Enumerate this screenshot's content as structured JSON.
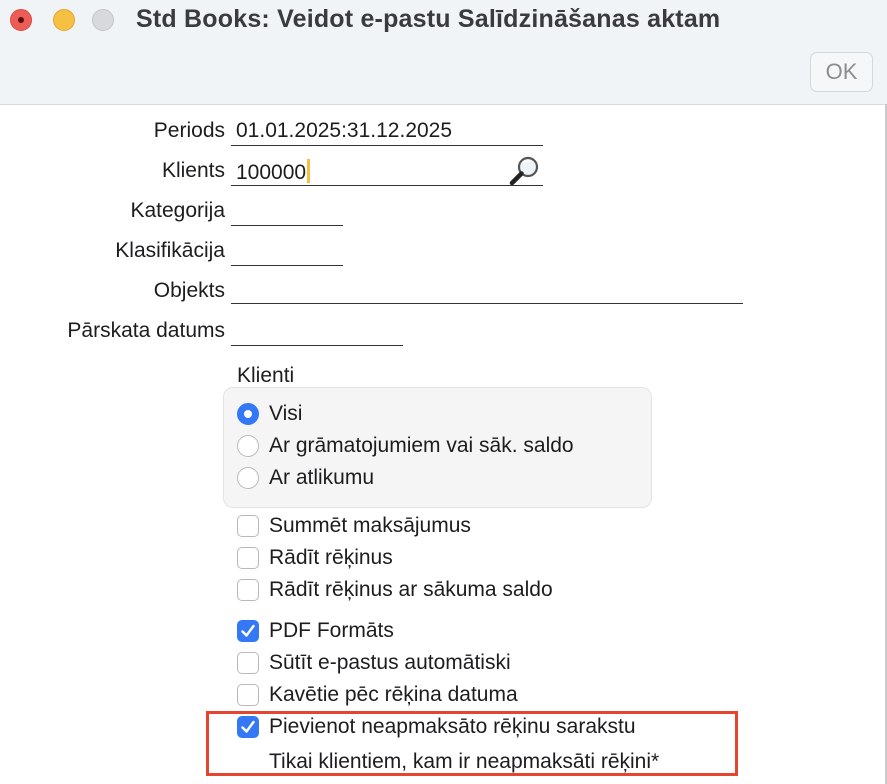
{
  "window": {
    "title": "Std Books: Veidot e-pastu Salīdzināšanas aktam",
    "ok_label": "OK"
  },
  "form": {
    "periods_label": "Periods",
    "periods_value": "01.01.2025:31.12.2025",
    "klients_label": "Klients",
    "klients_value": "100000",
    "kategorija_label": "Kategorija",
    "kategorija_value": "",
    "klasifikacija_label": "Klasifikācija",
    "klasifikacija_value": "",
    "objekts_label": "Objekts",
    "objekts_value": "",
    "parskata_label": "Pārskata datums",
    "parskata_value": ""
  },
  "klienti_group": {
    "title": "Klienti",
    "options": [
      {
        "label": "Visi",
        "selected": true
      },
      {
        "label": "Ar grāmatojumiem vai sāk. saldo",
        "selected": false
      },
      {
        "label": "Ar atlikumu",
        "selected": false
      }
    ]
  },
  "checkboxes": [
    {
      "label": "Summēt maksājumus",
      "checked": false
    },
    {
      "label": "Rādīt rēķinus",
      "checked": false
    },
    {
      "label": "Rādīt rēķinus ar sākuma saldo",
      "checked": false
    },
    {
      "label": "PDF Formāts",
      "checked": true
    },
    {
      "label": "Sūtīt e-pastus automātiski",
      "checked": false
    },
    {
      "label": "Kavētie pēc rēķina datuma",
      "checked": false
    },
    {
      "label": "Pievienot neapmaksāto rēķinu sarakstu",
      "checked": true
    },
    {
      "label": "Tikai klientiem, kam ir neapmaksāti rēķini*",
      "checked": null
    }
  ],
  "colors": {
    "accent": "#3478f6",
    "highlight": "#e5452f",
    "caret": "#f6c143"
  },
  "icons": {
    "search": "magnifying-glass-icon"
  }
}
